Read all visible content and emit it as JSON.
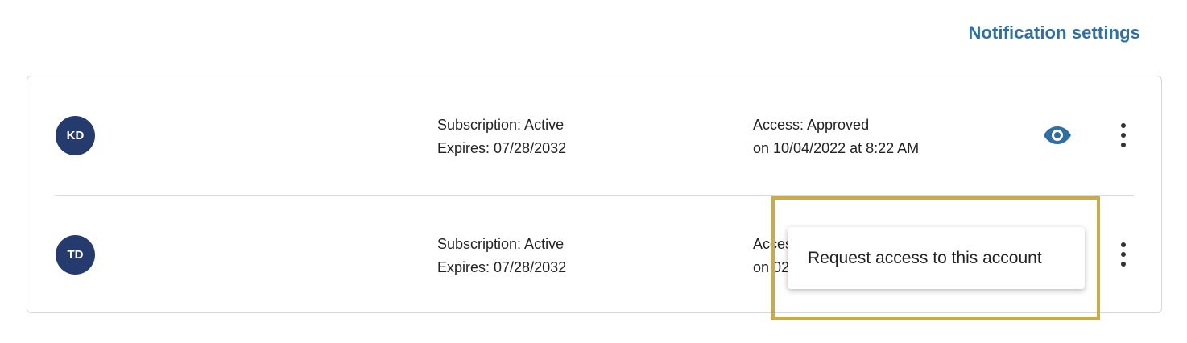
{
  "header": {
    "notification_settings_label": "Notification settings"
  },
  "accounts": [
    {
      "initials": "KD",
      "subscription": "Subscription: Active",
      "expires": "Expires: 07/28/2032",
      "access": "Access: Approved",
      "access_date": "on 10/04/2022 at 8:22 AM",
      "has_view_icon": true
    },
    {
      "initials": "TD",
      "subscription": "Subscription: Active",
      "expires": "Expires: 07/28/2032",
      "access": "Access: Approved",
      "access_date": "on 02",
      "has_view_icon": false
    }
  ],
  "context_menu": {
    "items": [
      {
        "label": "Request access to this account"
      }
    ]
  },
  "icons": {
    "view": "eye-icon",
    "more": "more-vertical-icon"
  },
  "colors": {
    "link": "#2f6fa3",
    "avatar_bg": "#253b6e",
    "highlight_border": "#c9ab4a",
    "icon_blue": "#2f6fa3"
  }
}
